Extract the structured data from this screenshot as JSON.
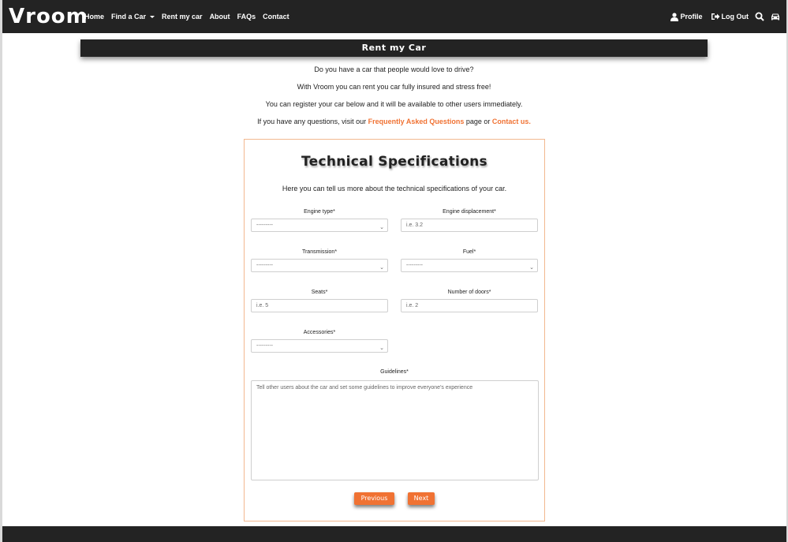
{
  "navbar": {
    "brand": "Vroom",
    "links": [
      "Home",
      "Find a Car",
      "Rent my car",
      "About",
      "FAQs",
      "Contact"
    ],
    "profile_label": "Profile",
    "logout_label": "Log Out"
  },
  "page": {
    "title": "Rent my Car",
    "intro": {
      "line1": "Do you have a car that people would love to drive?",
      "line2": "With Vroom you can rent you car fully insured and stress free!",
      "line3": "You can register your car below and it will be available to other users immediately.",
      "line4_prefix": "If you have any questions, visit our ",
      "faq_link": "Frequently Asked Questions",
      "line4_middle": " page or ",
      "contact_link": "Contact us."
    }
  },
  "form": {
    "title": "Technical Specifications",
    "subtitle": "Here you can tell us more about the technical specifications of your car.",
    "engine_type": {
      "label": "Engine type*",
      "value": "---------"
    },
    "engine_displacement": {
      "label": "Engine displacement*",
      "placeholder": "i.e. 3.2"
    },
    "transmission": {
      "label": "Transmission*",
      "value": "---------"
    },
    "fuel": {
      "label": "Fuel*",
      "value": "---------"
    },
    "seats": {
      "label": "Seats*",
      "placeholder": "i.e. 5"
    },
    "doors": {
      "label": "Number of doors*",
      "placeholder": "i.e. 2"
    },
    "accessories": {
      "label": "Accessories*",
      "value": "---------"
    },
    "guidelines": {
      "label": "Guidelines*",
      "placeholder": "Tell other users about the car and set some guidelines to improve everyone's experience"
    },
    "previous_label": "Previous",
    "next_label": "Next"
  },
  "colors": {
    "accent": "#f07233",
    "dark": "#232323",
    "card_border": "#f2b88f"
  }
}
